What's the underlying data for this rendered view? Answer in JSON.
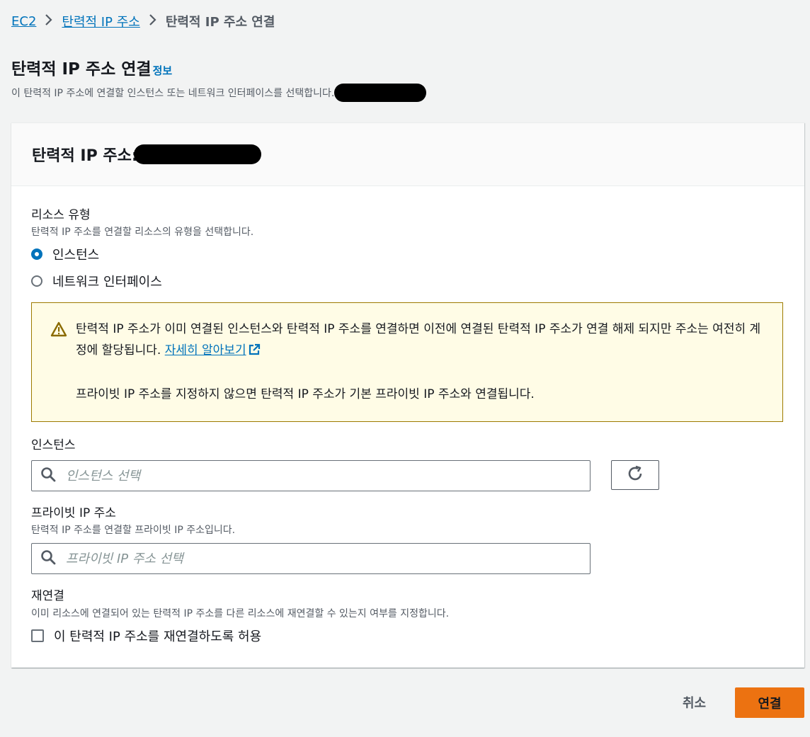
{
  "breadcrumb": {
    "items": [
      "EC2",
      "탄력적 IP 주소",
      "탄력적 IP 주소 연결"
    ]
  },
  "header": {
    "title": "탄력적 IP 주소 연결",
    "info_link": "정보",
    "description": "이 탄력적 IP 주소에 연결할 인스턴스 또는 네트워크 인터페이스를 선택합니다."
  },
  "card": {
    "title": "탄력적 IP 주소:",
    "resource_type": {
      "label": "리소스 유형",
      "description": "탄력적 IP 주소를 연결할 리소스의 유형을 선택합니다.",
      "options": [
        "인스턴스",
        "네트워크 인터페이스"
      ],
      "selected": "인스턴스"
    },
    "alert": {
      "text1": "탄력적 IP 주소가 이미 연결된 인스턴스와 탄력적 IP 주소를 연결하면 이전에 연결된 탄력적 IP 주소가 연결 해제 되지만 주소는 여전히 계정에 할당됩니다.",
      "link": "자세히 알아보기",
      "text2": "프라이빗 IP 주소를 지정하지 않으면 탄력적 IP 주소가 기본 프라이빗 IP 주소와 연결됩니다.",
      "icon": "warning-icon",
      "border_color": "#9d7a00",
      "background": "#fffce6"
    },
    "instance": {
      "label": "인스턴스",
      "placeholder": "인스턴스 선택",
      "value": ""
    },
    "private_ip": {
      "label": "프라이빗 IP 주소",
      "description": "탄력적 IP 주소를 연결할 프라이빗 IP 주소입니다.",
      "placeholder": "프라이빗 IP 주소 선택",
      "value": ""
    },
    "reassociation": {
      "label": "재연결",
      "description": "이미 리소스에 연결되어 있는 탄력적 IP 주소를 다른 리소스에 재연결할 수 있는지 여부를 지정합니다.",
      "checkbox_label": "이 탄력적 IP 주소를 재연결하도록 허용",
      "checked": false
    }
  },
  "footer": {
    "cancel": "취소",
    "submit": "연결",
    "primary_color": "#ec7211"
  }
}
